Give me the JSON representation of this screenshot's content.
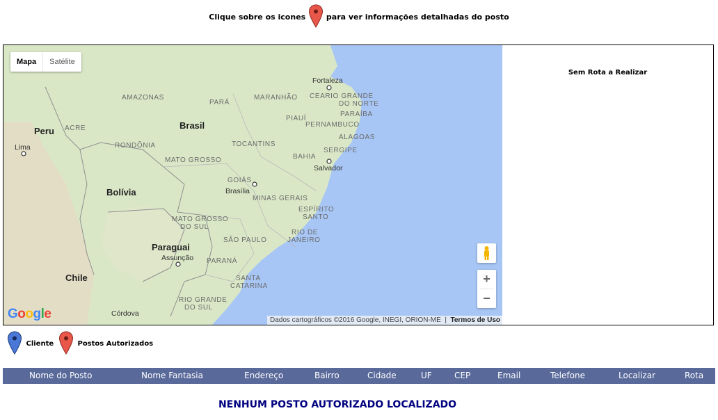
{
  "instructions": {
    "before": "Clique sobre os icones",
    "after": "para ver informações detalhadas do posto"
  },
  "map": {
    "type_controls": [
      "Mapa",
      "Satélite"
    ],
    "labels": {
      "countries": [
        "Peru",
        "Brasil",
        "Bolívia",
        "Paraguai",
        "Chile"
      ],
      "regions": [
        "AMAZONAS",
        "PARÁ",
        "MARANHÃO",
        "ACRE",
        "RONDÔNIA",
        "MATO GROSSO",
        "TOCANTINS",
        "PIAUÍ",
        "CEARÁ",
        "CEARIO GRANDE",
        "DO NORTE",
        "PARAÍBA",
        "PERNAMBUCO",
        "ALAGOAS",
        "SERGIPE",
        "BAHIA",
        "GOIÁS",
        "MINAS GERAIS",
        "ESPÍRITO",
        "SANTO",
        "MATO GROSSO",
        "DO SUL",
        "SÃO PAULO",
        "RIO DE",
        "JANEIRO",
        "PARANÁ",
        "SANTA",
        "CATARINA",
        "RIO GRANDE",
        "DO SUL"
      ],
      "cities": [
        "Lima",
        "Fortaleza",
        "Salvador",
        "Brasília",
        "Assunção",
        "Córdova"
      ]
    },
    "attribution": "Dados cartográficos ©2016 Google, INEGI, ORION-ME",
    "terms": "Termos de Uso",
    "google_logo": "Google",
    "water_color": "#a7c6f5",
    "land_color": "#d9e7c6"
  },
  "route_panel": {
    "text": "Sem Rota a Realizar"
  },
  "legend": {
    "client": {
      "label": "Cliente",
      "color": "#4a78d6"
    },
    "posts": {
      "label": "Postos Autorizados",
      "color": "#e8574a"
    }
  },
  "table": {
    "headers": [
      "Nome do Posto",
      "Nome Fantasia",
      "Endereço",
      "Bairro",
      "Cidade",
      "UF",
      "CEP",
      "Email",
      "Telefone",
      "Localizar",
      "Rota"
    ],
    "header_bg": "#58699a"
  },
  "empty_message": "NENHUM POSTO AUTORIZADO LOCALIZADO"
}
